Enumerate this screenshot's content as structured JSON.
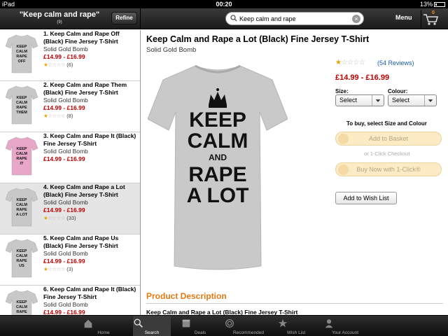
{
  "status_bar": {
    "device": "iPad",
    "time": "00:20",
    "battery": "13%"
  },
  "header": {
    "search_title": "\"Keep calm and rape\"",
    "result_count": "(9)",
    "refine_label": "Refine",
    "search_value": "Keep calm and rape",
    "clear_label": "×",
    "menu_label": "Menu",
    "cart_count": "0"
  },
  "results": [
    {
      "title": "1. Keep Calm and Rape Off (Black) Fine Jersey T-Shirt",
      "brand": "Solid Gold Bomb",
      "price": "£14.99 - £16.99",
      "rating": 1,
      "reviews": "(6)",
      "shirt_color": "#c8c8c8",
      "shirt_text": [
        "KEEP",
        "CALM",
        "RAPE",
        "OFF"
      ]
    },
    {
      "title": "2. Keep Calm and Rape Them (Black) Fine Jersey T-Shirt",
      "brand": "Solid Gold Bomb",
      "price": "£14.99 - £16.99",
      "rating": 1,
      "reviews": "(8)",
      "shirt_color": "#c8c8c8",
      "shirt_text": [
        "KEEP",
        "CALM",
        "RAPE",
        "THEM"
      ]
    },
    {
      "title": "3. Keep Calm and Rape It (Black) Fine Jersey T-Shirt",
      "brand": "Solid Gold Bomb",
      "price": "£14.99 - £16.99",
      "rating": null,
      "reviews": "",
      "shirt_color": "#e8a7c8",
      "shirt_text": [
        "KEEP",
        "CALM",
        "RAPE",
        "IT"
      ]
    },
    {
      "title": "4. Keep Calm and Rape a Lot (Black) Fine Jersey T-Shirt",
      "brand": "Solid Gold Bomb",
      "price": "£14.99 - £16.99",
      "rating": 1,
      "reviews": "(33)",
      "shirt_color": "#c8c8c8",
      "shirt_text": [
        "KEEP",
        "CALM",
        "RAPE",
        "A LOT"
      ]
    },
    {
      "title": "5. Keep Calm and Rape Us (Black) Fine Jersey T-Shirt",
      "brand": "Solid Gold Bomb",
      "price": "£14.99 - £16.99",
      "rating": 1,
      "reviews": "(3)",
      "shirt_color": "#c8c8c8",
      "shirt_text": [
        "KEEP",
        "CALM",
        "RAPE",
        "US"
      ]
    },
    {
      "title": "6. Keep Calm and Rape It (Black) Fine Jersey T-Shirt",
      "brand": "Solid Gold Bomb",
      "price": "£14.99 - £16.99",
      "rating": null,
      "reviews": "",
      "shirt_color": "#c8c8c8",
      "shirt_text": [
        "KEEP",
        "CALM",
        "RAPE",
        "IT"
      ]
    }
  ],
  "selected_index": 3,
  "product": {
    "title": "Keep Calm and Rape a Lot (Black) Fine Jersey T-Shirt",
    "brand": "Solid Gold Bomb",
    "shirt_text": [
      "KEEP",
      "CALM",
      "AND",
      "RAPE",
      "A LOT"
    ],
    "rating": 1,
    "reviews_link": "(54 Reviews)",
    "price": "£14.99 - £16.99",
    "size_label": "Size:",
    "size_value": "Select",
    "colour_label": "Colour:",
    "colour_value": "Select",
    "to_buy_text": "To buy, select Size and Colour",
    "add_to_basket": "Add to Basket",
    "one_click_text": "or 1-Click Checkout",
    "buy_now": "Buy Now with 1-Click®",
    "wish_list": "Add to Wish List",
    "description_heading": "Product Description",
    "description_subtitle": "Keep Calm and Rape a Lot (Black) Fine Jersey T-Shirt"
  },
  "tabs": [
    {
      "label": "Home",
      "icon": "home-icon"
    },
    {
      "label": "Search",
      "icon": "search-icon"
    },
    {
      "label": "Deals",
      "icon": "deals-icon"
    },
    {
      "label": "Recommended",
      "icon": "recommended-icon"
    },
    {
      "label": "Wish List",
      "icon": "wish-list-icon"
    },
    {
      "label": "Your Account",
      "icon": "account-icon"
    }
  ],
  "active_tab": 1,
  "colors": {
    "price": "#b00000",
    "accent": "#e47911",
    "link": "#1b5ca8",
    "star": "#e8a400"
  }
}
